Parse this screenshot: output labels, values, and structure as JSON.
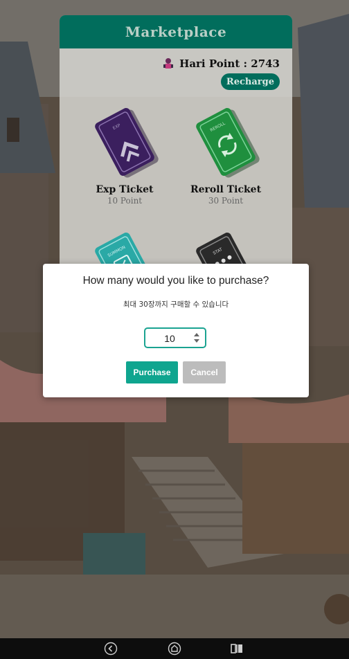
{
  "market": {
    "title": "Marketplace",
    "points_label": "Hari Point : 2743",
    "recharge_label": "Recharge",
    "tickets": [
      {
        "name": "Exp Ticket",
        "price": "10 Point",
        "tag": "EXP",
        "color": "#3b1f5e",
        "icon": "double-chevron-up-icon"
      },
      {
        "name": "Reroll Ticket",
        "price": "30 Point",
        "tag": "REROLL",
        "color": "#1f8f3e",
        "icon": "refresh-icon"
      },
      {
        "name": "",
        "price": "",
        "tag": "SUMMON",
        "color": "#2aa9a6",
        "icon": "summon-icon"
      },
      {
        "name": "",
        "price": "",
        "tag": "STAT",
        "color": "#2a2a2a",
        "icon": "stat-icon"
      }
    ]
  },
  "modal": {
    "title": "How many would you like to purchase?",
    "subtitle": "최대 30장까지 구매할 수 있습니다",
    "quantity": "10",
    "purchase_label": "Purchase",
    "cancel_label": "Cancel"
  },
  "navbar": {
    "back_icon": "back-icon",
    "home_icon": "home-icon",
    "recents_icon": "recents-icon"
  },
  "colors": {
    "accent": "#016d5c",
    "purchase": "#0fa58f",
    "cancel": "#bcbcbc"
  }
}
